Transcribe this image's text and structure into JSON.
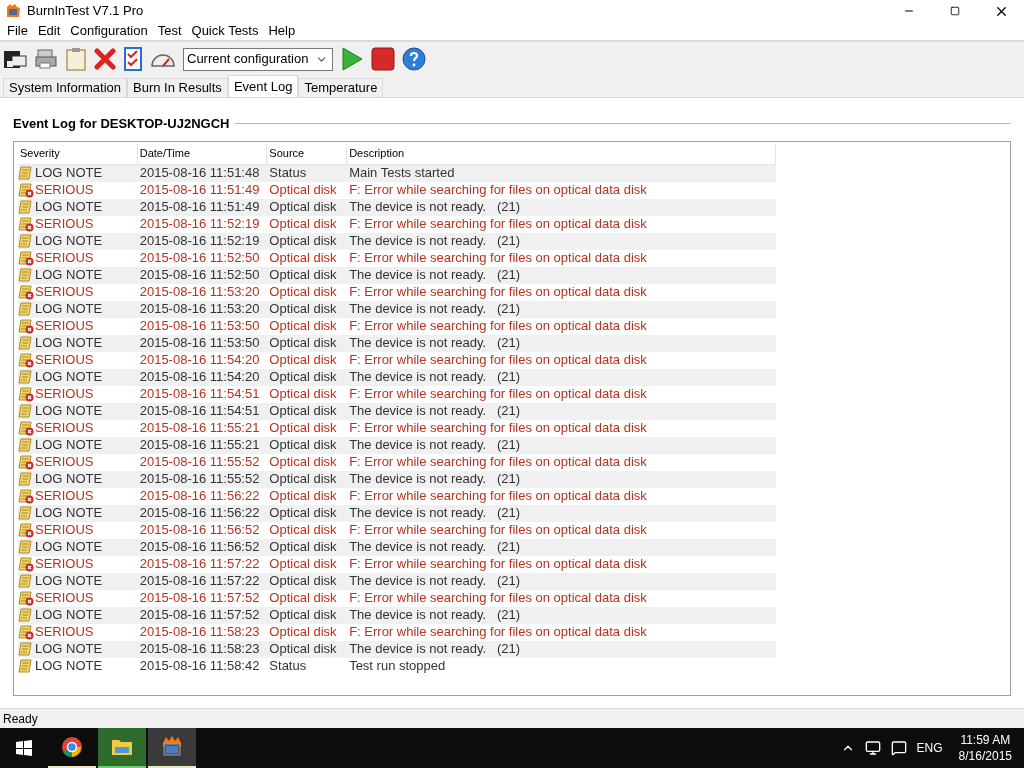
{
  "window": {
    "title": "BurnInTest V7.1 Pro"
  },
  "menu": [
    "File",
    "Edit",
    "Configuration",
    "Test",
    "Quick Tests",
    "Help"
  ],
  "toolbar": {
    "config_select": "Current configuration"
  },
  "tabs": [
    {
      "label": "System Information",
      "selected": false
    },
    {
      "label": "Burn In Results",
      "selected": false
    },
    {
      "label": "Event Log",
      "selected": true
    },
    {
      "label": "Temperature",
      "selected": false
    }
  ],
  "heading": "Event Log for DESKTOP-UJ2NGCH",
  "table": {
    "columns": [
      "Severity",
      "Date/Time",
      "Source",
      "Description"
    ],
    "rows": [
      {
        "kind": "note",
        "severity": "LOG NOTE",
        "time": "2015-08-16 11:51:48",
        "source": "Status",
        "description": "Main Tests started"
      },
      {
        "kind": "serious",
        "severity": "SERIOUS",
        "time": "2015-08-16 11:51:49",
        "source": "Optical disk",
        "description": "F: Error while searching for files on optical data disk"
      },
      {
        "kind": "note",
        "severity": "LOG NOTE",
        "time": "2015-08-16 11:51:49",
        "source": "Optical disk",
        "description": "The device is not ready.   (21)"
      },
      {
        "kind": "serious",
        "severity": "SERIOUS",
        "time": "2015-08-16 11:52:19",
        "source": "Optical disk",
        "description": "F: Error while searching for files on optical data disk"
      },
      {
        "kind": "note",
        "severity": "LOG NOTE",
        "time": "2015-08-16 11:52:19",
        "source": "Optical disk",
        "description": "The device is not ready.   (21)"
      },
      {
        "kind": "serious",
        "severity": "SERIOUS",
        "time": "2015-08-16 11:52:50",
        "source": "Optical disk",
        "description": "F: Error while searching for files on optical data disk"
      },
      {
        "kind": "note",
        "severity": "LOG NOTE",
        "time": "2015-08-16 11:52:50",
        "source": "Optical disk",
        "description": "The device is not ready.   (21)"
      },
      {
        "kind": "serious",
        "severity": "SERIOUS",
        "time": "2015-08-16 11:53:20",
        "source": "Optical disk",
        "description": "F: Error while searching for files on optical data disk"
      },
      {
        "kind": "note",
        "severity": "LOG NOTE",
        "time": "2015-08-16 11:53:20",
        "source": "Optical disk",
        "description": "The device is not ready.   (21)"
      },
      {
        "kind": "serious",
        "severity": "SERIOUS",
        "time": "2015-08-16 11:53:50",
        "source": "Optical disk",
        "description": "F: Error while searching for files on optical data disk"
      },
      {
        "kind": "note",
        "severity": "LOG NOTE",
        "time": "2015-08-16 11:53:50",
        "source": "Optical disk",
        "description": "The device is not ready.   (21)"
      },
      {
        "kind": "serious",
        "severity": "SERIOUS",
        "time": "2015-08-16 11:54:20",
        "source": "Optical disk",
        "description": "F: Error while searching for files on optical data disk"
      },
      {
        "kind": "note",
        "severity": "LOG NOTE",
        "time": "2015-08-16 11:54:20",
        "source": "Optical disk",
        "description": "The device is not ready.   (21)"
      },
      {
        "kind": "serious",
        "severity": "SERIOUS",
        "time": "2015-08-16 11:54:51",
        "source": "Optical disk",
        "description": "F: Error while searching for files on optical data disk"
      },
      {
        "kind": "note",
        "severity": "LOG NOTE",
        "time": "2015-08-16 11:54:51",
        "source": "Optical disk",
        "description": "The device is not ready.   (21)"
      },
      {
        "kind": "serious",
        "severity": "SERIOUS",
        "time": "2015-08-16 11:55:21",
        "source": "Optical disk",
        "description": "F: Error while searching for files on optical data disk"
      },
      {
        "kind": "note",
        "severity": "LOG NOTE",
        "time": "2015-08-16 11:55:21",
        "source": "Optical disk",
        "description": "The device is not ready.   (21)"
      },
      {
        "kind": "serious",
        "severity": "SERIOUS",
        "time": "2015-08-16 11:55:52",
        "source": "Optical disk",
        "description": "F: Error while searching for files on optical data disk"
      },
      {
        "kind": "note",
        "severity": "LOG NOTE",
        "time": "2015-08-16 11:55:52",
        "source": "Optical disk",
        "description": "The device is not ready.   (21)"
      },
      {
        "kind": "serious",
        "severity": "SERIOUS",
        "time": "2015-08-16 11:56:22",
        "source": "Optical disk",
        "description": "F: Error while searching for files on optical data disk"
      },
      {
        "kind": "note",
        "severity": "LOG NOTE",
        "time": "2015-08-16 11:56:22",
        "source": "Optical disk",
        "description": "The device is not ready.   (21)"
      },
      {
        "kind": "serious",
        "severity": "SERIOUS",
        "time": "2015-08-16 11:56:52",
        "source": "Optical disk",
        "description": "F: Error while searching for files on optical data disk"
      },
      {
        "kind": "note",
        "severity": "LOG NOTE",
        "time": "2015-08-16 11:56:52",
        "source": "Optical disk",
        "description": "The device is not ready.   (21)"
      },
      {
        "kind": "serious",
        "severity": "SERIOUS",
        "time": "2015-08-16 11:57:22",
        "source": "Optical disk",
        "description": "F: Error while searching for files on optical data disk"
      },
      {
        "kind": "note",
        "severity": "LOG NOTE",
        "time": "2015-08-16 11:57:22",
        "source": "Optical disk",
        "description": "The device is not ready.   (21)"
      },
      {
        "kind": "serious",
        "severity": "SERIOUS",
        "time": "2015-08-16 11:57:52",
        "source": "Optical disk",
        "description": "F: Error while searching for files on optical data disk"
      },
      {
        "kind": "note",
        "severity": "LOG NOTE",
        "time": "2015-08-16 11:57:52",
        "source": "Optical disk",
        "description": "The device is not ready.   (21)"
      },
      {
        "kind": "serious",
        "severity": "SERIOUS",
        "time": "2015-08-16 11:58:23",
        "source": "Optical disk",
        "description": "F: Error while searching for files on optical data disk"
      },
      {
        "kind": "note",
        "severity": "LOG NOTE",
        "time": "2015-08-16 11:58:23",
        "source": "Optical disk",
        "description": "The device is not ready.   (21)"
      },
      {
        "kind": "note",
        "severity": "LOG NOTE",
        "time": "2015-08-16 11:58:42",
        "source": "Status",
        "description": "Test run stopped"
      }
    ]
  },
  "status_bar": "Ready",
  "taskbar": {
    "language": "ENG",
    "time": "11:59 AM",
    "date": "8/16/2015"
  }
}
